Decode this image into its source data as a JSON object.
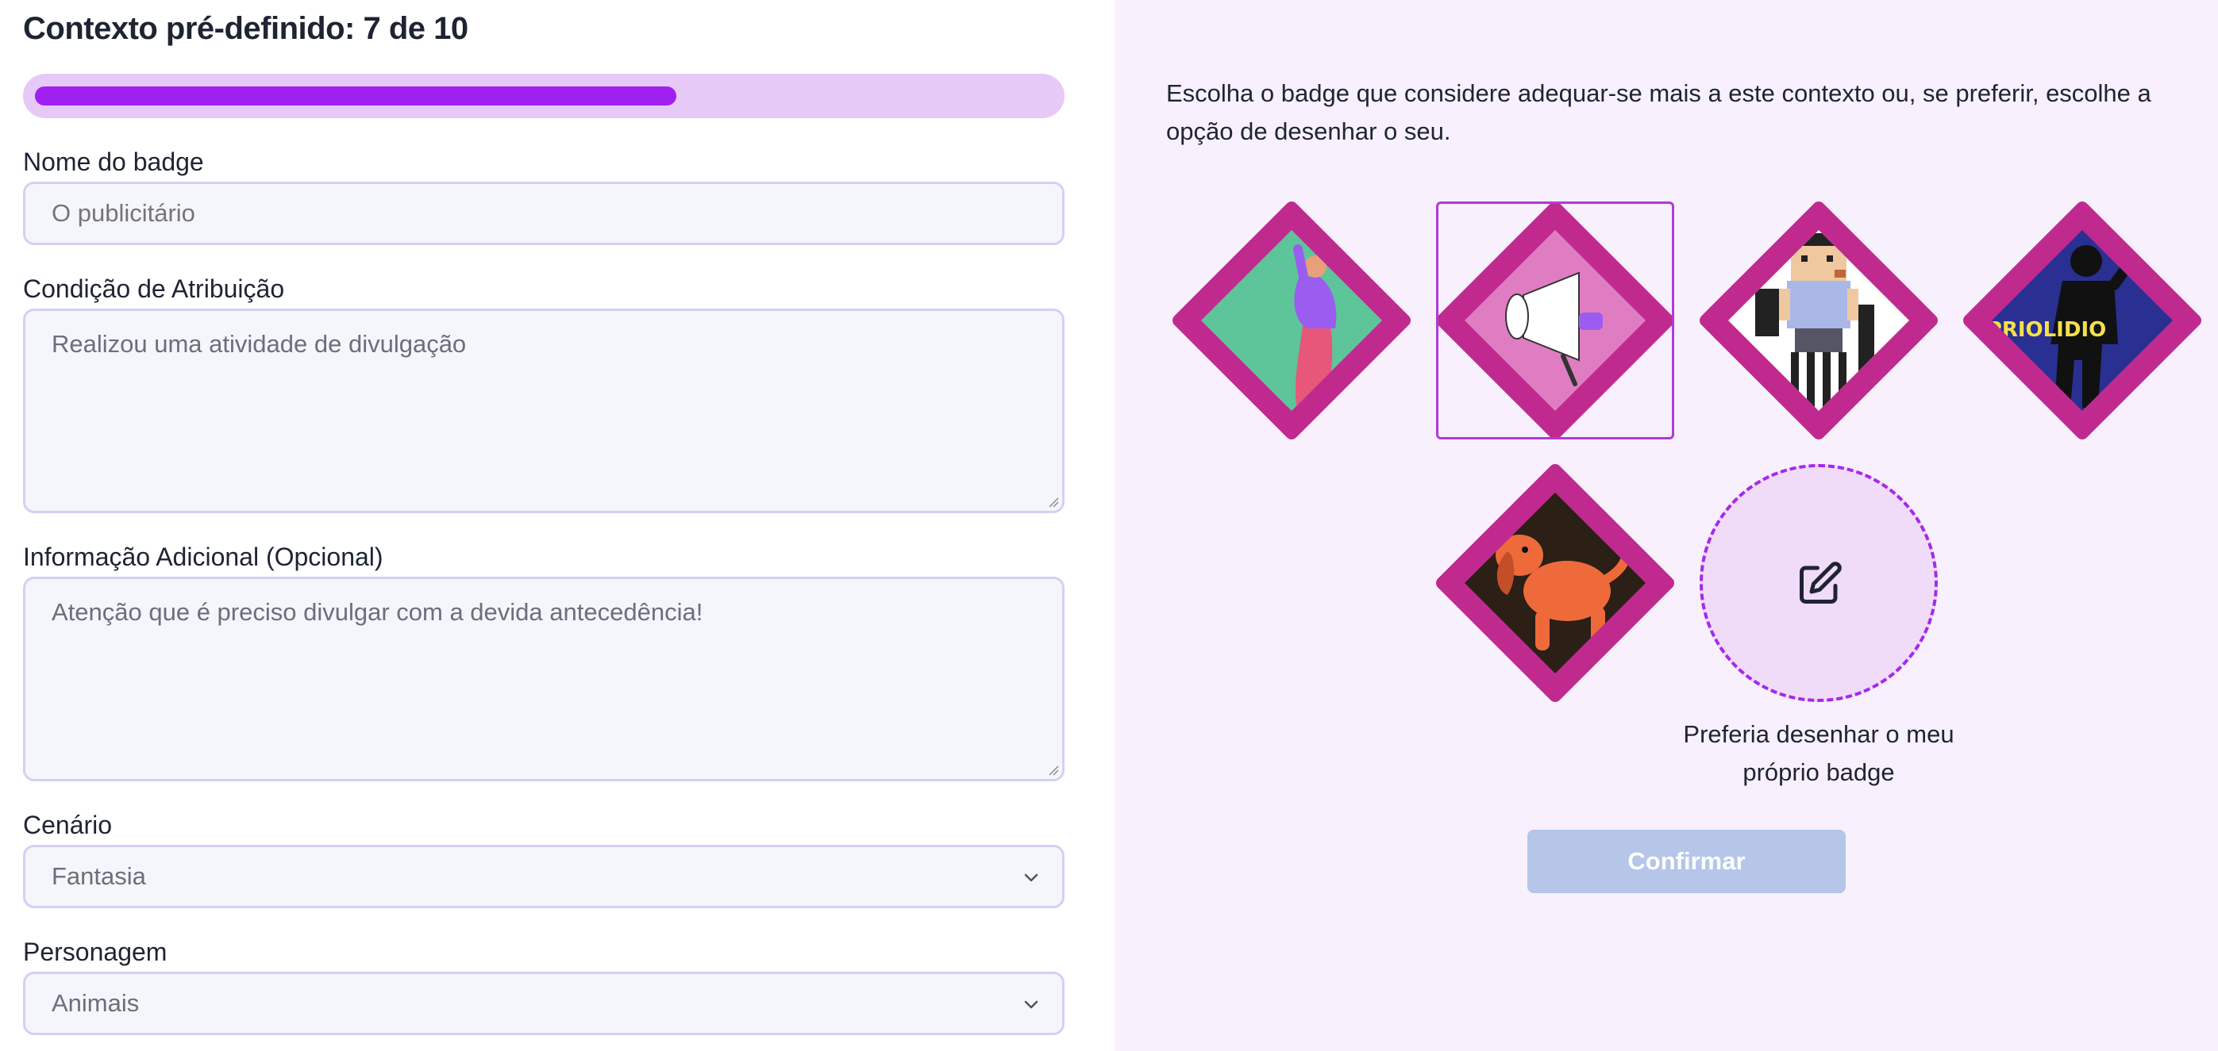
{
  "header": {
    "title": "Contexto pré-definido: 7 de 10"
  },
  "progress": {
    "current": 7,
    "total": 10,
    "fraction": 0.63
  },
  "form": {
    "badge_name": {
      "label": "Nome do badge",
      "placeholder": "O publicitário"
    },
    "condition": {
      "label": "Condição de Atribuição",
      "placeholder": "Realizou uma atividade de divulgação"
    },
    "additional_info": {
      "label": "Informação Adicional (Opcional)",
      "placeholder": "Atenção que é preciso divulgar com a devida antecedência!"
    },
    "scenario": {
      "label": "Cenário",
      "selected": "Fantasia"
    },
    "character": {
      "label": "Personagem",
      "selected": "Animais"
    }
  },
  "right": {
    "instructions": "Escolha o badge que considere adequar-se mais a este contexto ou, se preferir, escolhe a opção de desenhar o seu.",
    "badges": [
      {
        "name": "person-illustration",
        "selected": false
      },
      {
        "name": "megaphone",
        "selected": true
      },
      {
        "name": "pixel-character",
        "selected": false
      },
      {
        "name": "priolidio",
        "selected": false,
        "text": "PRIOLIDIO"
      },
      {
        "name": "dog",
        "selected": false
      }
    ],
    "draw_own": {
      "caption": "Preferia desenhar o meu próprio badge",
      "icon": "edit-icon"
    },
    "confirm_label": "Confirmar"
  },
  "colors": {
    "accent": "#a020f0",
    "badge_frame": "#c02a8f",
    "confirm_disabled": "#b5c6e8",
    "right_panel_bg": "#f8f1fd"
  }
}
